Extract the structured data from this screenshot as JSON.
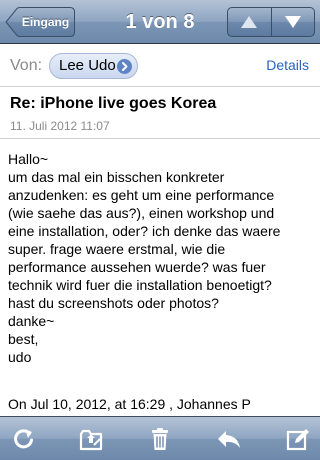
{
  "nav": {
    "back_label": "Eingang",
    "title": "1 von 8"
  },
  "from": {
    "label": "Von:",
    "contact": "Lee Udo",
    "details": "Details"
  },
  "message": {
    "subject": "Re: iPhone live goes Korea",
    "date": "11. Juli 2012 11:07",
    "body_lines": [
      "Hallo~",
      "um das mal ein bisschen konkreter",
      "anzudenken: es geht um eine performance",
      "(wie saehe das aus?), einen workshop und",
      "eine installation, oder? ich denke das waere",
      "super. frage waere erstmal, wie die",
      "performance aussehen wuerde? was fuer",
      "technik wird fuer die installation benoetigt?",
      "hast du screenshots oder photos?",
      "danke~",
      "best,",
      "udo"
    ],
    "quote_header": "On Jul 10, 2012, at 16:29 , Johannes P"
  },
  "colors": {
    "bar_top": "#b4c3d6",
    "bar_bottom": "#6d89ab",
    "link": "#2a64b8",
    "pill": "#c9d7ee"
  },
  "icons": {
    "refresh": "refresh-icon",
    "move": "move-to-folder-icon",
    "trash": "trash-icon",
    "reply": "reply-icon",
    "compose": "compose-icon",
    "prev": "arrow-up-icon",
    "next": "arrow-down-icon"
  }
}
